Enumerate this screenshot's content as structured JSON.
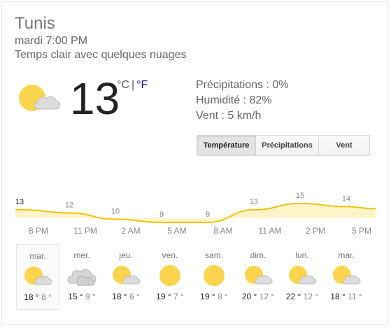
{
  "location": "Tunis",
  "datetime": "mardi 7:00 PM",
  "condition": "Temps clair avec quelques nuages",
  "current": {
    "temperature": "13",
    "unit_c": "°C",
    "unit_sep": "|",
    "unit_f": "°F",
    "icon": "partly-cloudy-icon"
  },
  "details": {
    "precipitation": "Précipitations : 0%",
    "humidity": "Humidité : 82%",
    "wind": "Vent : 5 km/h"
  },
  "tabs": [
    {
      "label": "Température",
      "active": true
    },
    {
      "label": "Précipitations",
      "active": false
    },
    {
      "label": "Vent",
      "active": false
    }
  ],
  "hourly_times": [
    "8 PM",
    "11 PM",
    "2 AM",
    "5 AM",
    "8 AM",
    "11 AM",
    "2 PM",
    "5 PM"
  ],
  "chart_data": {
    "type": "area",
    "labels": [
      "13",
      "12",
      "10",
      "9",
      "9",
      "13",
      "15",
      "14"
    ],
    "values": [
      13,
      12,
      10,
      9,
      9,
      13,
      15,
      14
    ],
    "color": "#f4c20d",
    "fill": "#fff5c8"
  },
  "days": [
    {
      "name": "mar.",
      "icon": "partly-cloudy-icon",
      "high": "18 °",
      "low": "8 °",
      "selected": true
    },
    {
      "name": "mer.",
      "icon": "cloudy-icon",
      "high": "15 °",
      "low": "9 °",
      "selected": false
    },
    {
      "name": "jeu.",
      "icon": "partly-cloudy-icon",
      "high": "18 °",
      "low": "6 °",
      "selected": false
    },
    {
      "name": "ven.",
      "icon": "sun-icon",
      "high": "19 °",
      "low": "7 °",
      "selected": false
    },
    {
      "name": "sam.",
      "icon": "sun-icon",
      "high": "19 °",
      "low": "8 °",
      "selected": false
    },
    {
      "name": "dim.",
      "icon": "partly-cloudy-icon",
      "high": "20 °",
      "low": "12 °",
      "selected": false
    },
    {
      "name": "lun.",
      "icon": "partly-cloudy-icon",
      "high": "22 °",
      "low": "12 °",
      "selected": false
    },
    {
      "name": "mar.",
      "icon": "partly-cloudy-icon",
      "high": "18 °",
      "low": "11 °",
      "selected": false
    }
  ]
}
